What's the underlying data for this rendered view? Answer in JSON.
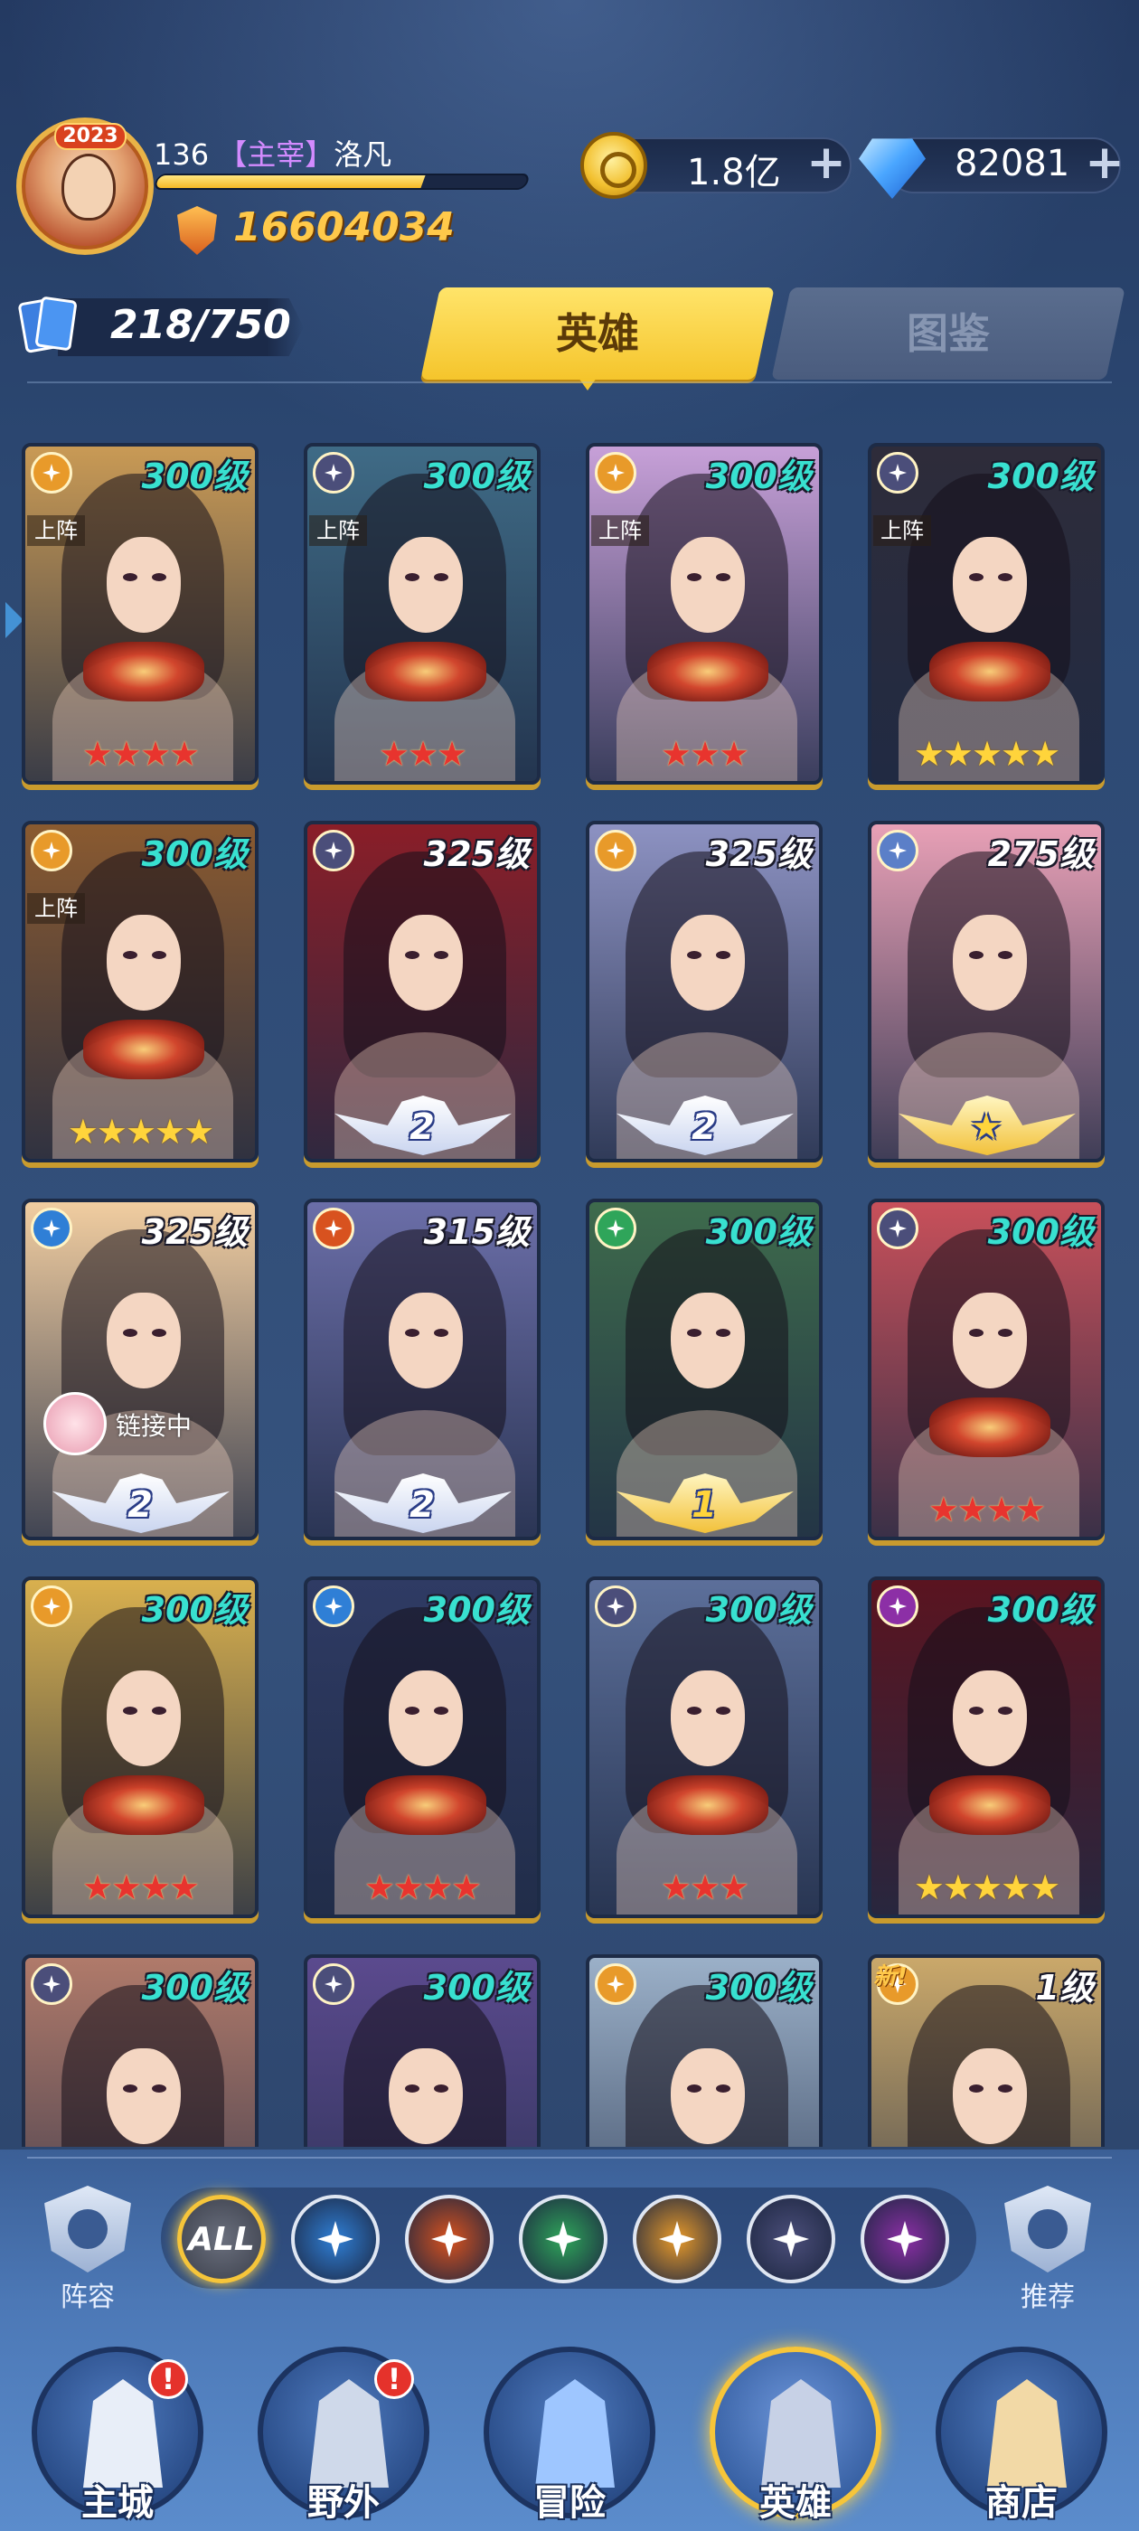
{
  "player": {
    "avatar_year": "2023",
    "level": "136",
    "title": "【主宰】",
    "name": "洛凡",
    "xp_progress": 0.72,
    "power": "16604034"
  },
  "resources": {
    "gold": "1.8亿",
    "diamonds": "82081",
    "plus": "+"
  },
  "collection": {
    "card_count": "218/750"
  },
  "tabs": [
    {
      "label": "英雄",
      "active": true
    },
    {
      "label": "图鉴",
      "active": false
    }
  ],
  "heroes": [
    {
      "level": "300级",
      "element": "light",
      "deployed": "上阵",
      "stars": "★★★★",
      "star_color": "red",
      "art": "#c99a55"
    },
    {
      "level": "300级",
      "element": "void",
      "deployed": "上阵",
      "stars": "★★★",
      "star_color": "red",
      "art": "#3f6b86"
    },
    {
      "level": "300级",
      "element": "light",
      "deployed": "上阵",
      "stars": "★★★",
      "star_color": "red",
      "art": "#c7a0d8"
    },
    {
      "level": "300级",
      "element": "void",
      "deployed": "上阵",
      "stars": "★★★★★",
      "star_color": "gold",
      "art": "#2e2c3a"
    },
    {
      "level": "300级",
      "element": "light",
      "deployed": "上阵",
      "stars": "★★★★★",
      "star_color": "gold",
      "art": "#8a5a30"
    },
    {
      "level": "325级",
      "element": "void",
      "deployed": "",
      "stars": "",
      "badge": "2",
      "art": "#8a1e28"
    },
    {
      "level": "325级",
      "element": "light",
      "deployed": "",
      "stars": "",
      "badge": "2",
      "art": "#8d92c2"
    },
    {
      "level": "275级",
      "element": "sp",
      "deployed": "",
      "stars": "",
      "badge": "★",
      "badge_gold": true,
      "art": "#e8a0b6"
    },
    {
      "level": "325级",
      "element": "water",
      "deployed": "",
      "stars": "",
      "badge": "2",
      "linking": "链接中",
      "art": "#f1cda0"
    },
    {
      "level": "315级",
      "element": "fire",
      "deployed": "",
      "stars": "",
      "badge": "2",
      "art": "#6b6ea8"
    },
    {
      "level": "300级",
      "element": "wind",
      "deployed": "",
      "stars": "",
      "badge": "1",
      "badge_gold": true,
      "art": "#3e6b4c"
    },
    {
      "level": "300级",
      "element": "void",
      "deployed": "",
      "stars": "★★★★",
      "star_color": "red",
      "art": "#c8505a"
    },
    {
      "level": "300级",
      "element": "light",
      "deployed": "",
      "stars": "★★★★",
      "star_color": "red",
      "art": "#d9b04e"
    },
    {
      "level": "300级",
      "element": "water",
      "deployed": "",
      "stars": "★★★★",
      "star_color": "red",
      "art": "#2f3b64"
    },
    {
      "level": "300级",
      "element": "void",
      "deployed": "",
      "stars": "★★★",
      "star_color": "red",
      "art": "#5c6f9a"
    },
    {
      "level": "300级",
      "element": "dark",
      "deployed": "",
      "stars": "★★★★★",
      "star_color": "gold",
      "art": "#5a1420"
    },
    {
      "level": "300级",
      "element": "void",
      "deployed": "",
      "stars": "",
      "art": "#b07a6a"
    },
    {
      "level": "300级",
      "element": "void",
      "deployed": "",
      "stars": "",
      "art": "#5b4a8e"
    },
    {
      "level": "300级",
      "element": "light",
      "deployed": "",
      "stars": "",
      "art": "#9bb0c8"
    },
    {
      "level": "1级",
      "element": "light",
      "deployed": "",
      "stars": "",
      "new": "新!",
      "art": "#caa86a"
    }
  ],
  "element_colors": {
    "light": "#e89a2a",
    "void": "#4b4e7a",
    "sp": "#5b7fc8",
    "water": "#2f7fd6",
    "fire": "#d8521f",
    "wind": "#2fa55a",
    "dark": "#8c2fa6"
  },
  "filters": {
    "left_label": "阵容",
    "right_label": "推荐",
    "all_label": "ALL",
    "elements": [
      "water",
      "fire",
      "wind",
      "light",
      "void",
      "dark"
    ]
  },
  "nav": [
    {
      "label": "主城",
      "alert": "!"
    },
    {
      "label": "野外",
      "alert": "!"
    },
    {
      "label": "冒险",
      "alert": ""
    },
    {
      "label": "英雄",
      "alert": "",
      "active": true
    },
    {
      "label": "商店",
      "alert": ""
    }
  ]
}
